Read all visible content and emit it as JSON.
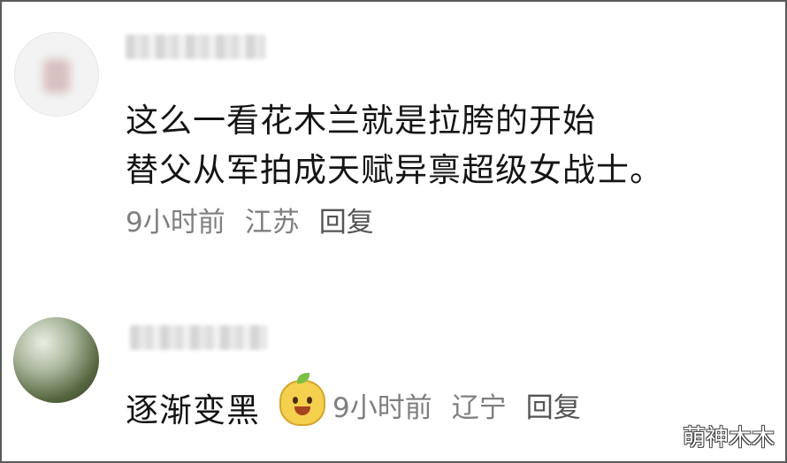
{
  "comments": [
    {
      "text_line1": "这么一看花木兰就是拉胯的开始",
      "text_line2": "替父从军拍成天赋异禀超级女战士。",
      "time": "9小时前",
      "location": "江苏",
      "reply": "回复"
    },
    {
      "text": "逐渐变黑",
      "emoji_icon": "mango-face-emoji-icon",
      "time": "9小时前",
      "location": "辽宁",
      "reply": "回复"
    }
  ],
  "watermark": "萌神木木"
}
